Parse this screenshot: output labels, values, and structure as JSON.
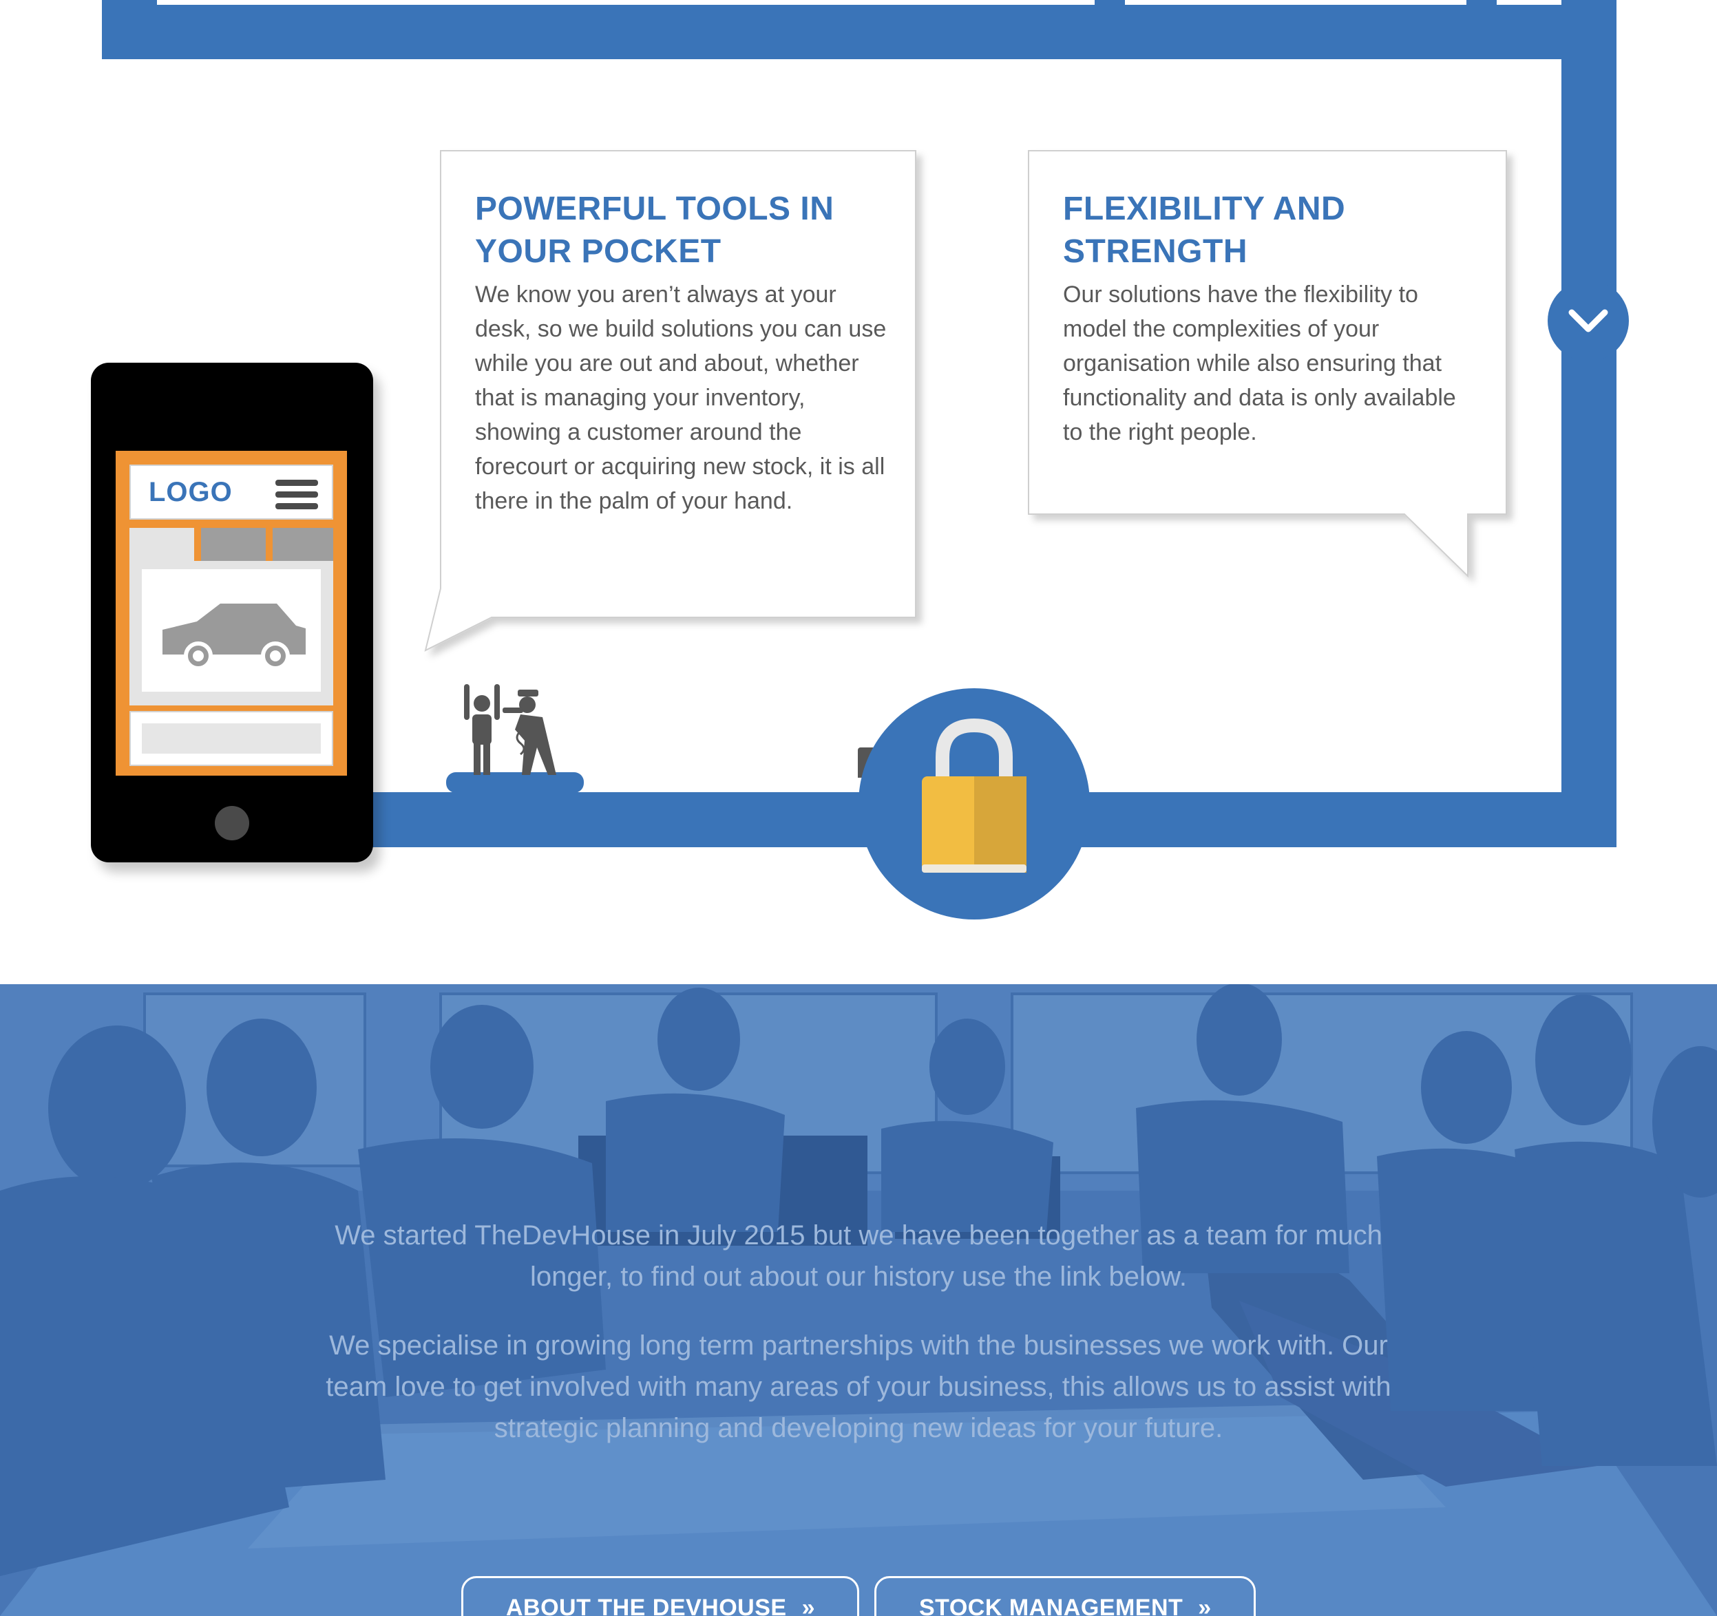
{
  "colors": {
    "brand_blue": "#3a74b8",
    "heading_blue": "#3a74b8",
    "body_text": "#595959",
    "phone_accent": "#ef9334",
    "lock_gold": "#f2bd42",
    "overlay_text": "#9db8dc"
  },
  "features": [
    {
      "title": "POWERFUL TOOLS IN YOUR POCKET",
      "body": "We know you aren’t always at your desk, so we build solutions you can use while you are out and about, whether that is managing your inventory, showing a customer around the forecourt or acquiring new stock, it is all there in the palm of your hand."
    },
    {
      "title": "FLEXIBILITY AND STRENGTH",
      "body": "Our solutions have the flexibility to model the complexities of your organisation while also ensuring that functionality and data is only available to the right people."
    }
  ],
  "phone_mock": {
    "logo": "LOGO"
  },
  "icons": {
    "scroll": "chevron-down-icon",
    "security_figures": "thief-and-police-icon",
    "lock": "padlock-icon",
    "car": "car-icon",
    "menu": "hamburger-menu-icon"
  },
  "about": {
    "paragraph_1": "We started TheDevHouse in July 2015 but we have been together as a team for much longer, to find out about our history use the link below.",
    "paragraph_2": "We specialise in growing long term partnerships with the businesses we work with. Our team love to get involved with many areas of your business, this allows us to assist with strategic planning and developing new ideas for your future.",
    "buttons": [
      {
        "label": "ABOUT THE DEVHOUSE",
        "icon": "double-chevron-right-icon"
      },
      {
        "label": "STOCK MANAGEMENT",
        "icon": "double-chevron-right-icon"
      }
    ]
  }
}
